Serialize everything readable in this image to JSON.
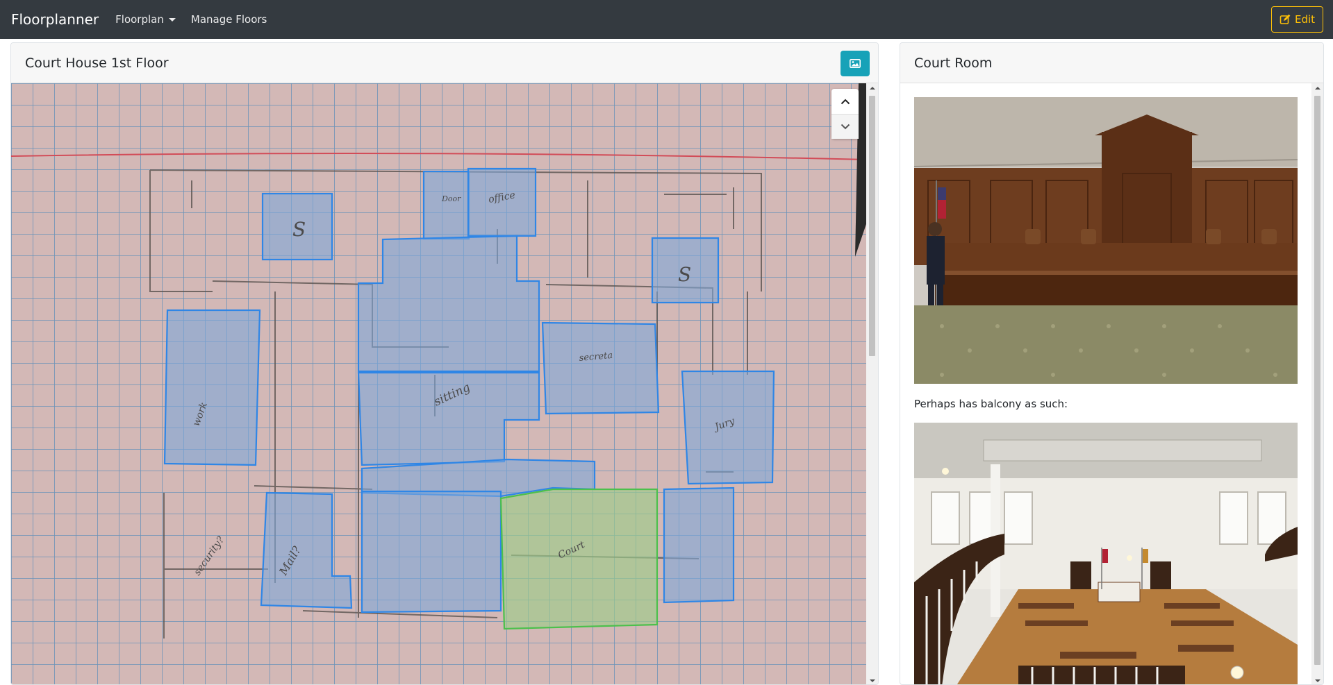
{
  "navbar": {
    "brand": "Floorplanner",
    "floorplan_label": "Floorplan",
    "manage_label": "Manage Floors",
    "edit_label": "Edit"
  },
  "floor_card": {
    "title": "Court House 1st Floor"
  },
  "room_card": {
    "title": "Court Room",
    "caption": "Perhaps has balcony as such:"
  },
  "sketch_labels": {
    "s1": "S",
    "s2": "S",
    "door": "Door",
    "office": "office",
    "sitting": "sitting",
    "secretary": "secreta",
    "jury": "Jury",
    "work": "work",
    "court": "Court",
    "mail": "Mail?",
    "security": "security?"
  },
  "colors": {
    "navbar": "#343a40",
    "edit_accent": "#ffc107",
    "image_button": "#17a2b8",
    "room_fill_blue": "#7fa6d8",
    "room_stroke_blue": "#2f86e6",
    "court_fill_green": "#9ccc8a",
    "court_stroke_green": "#4cc04c"
  }
}
